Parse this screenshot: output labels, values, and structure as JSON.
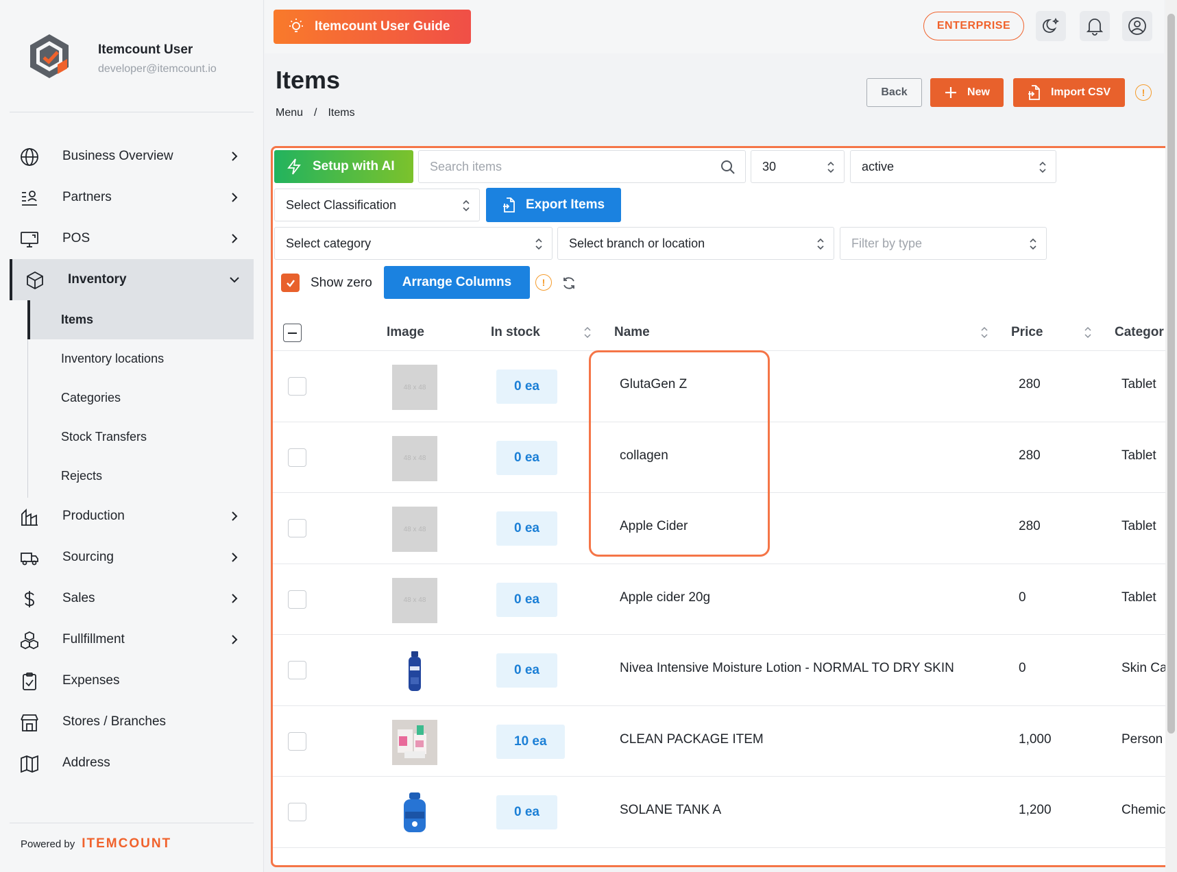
{
  "profile": {
    "name": "Itemcount User",
    "email": "developer@itemcount.io"
  },
  "nav": {
    "business_overview": "Business Overview",
    "partners": "Partners",
    "pos": "POS",
    "inventory": "Inventory",
    "production": "Production",
    "sourcing": "Sourcing",
    "sales": "Sales",
    "fulfillment": "Fullfillment",
    "expenses": "Expenses",
    "stores": "Stores / Branches",
    "address": "Address"
  },
  "subnav": {
    "items": "Items",
    "locations": "Inventory locations",
    "categories": "Categories",
    "transfers": "Stock Transfers",
    "rejects": "Rejects"
  },
  "footer": {
    "powered": "Powered by",
    "brand": "ITEMCOUNT"
  },
  "topbar": {
    "guide": "Itemcount User Guide",
    "plan": "ENTERPRISE"
  },
  "page": {
    "title": "Items",
    "breadcrumb": [
      "Menu",
      "/",
      "Items"
    ],
    "back": "Back",
    "new": "New",
    "import": "Import CSV"
  },
  "toolbar": {
    "ai": "Setup with AI",
    "search_placeholder": "Search items",
    "page_size": "30",
    "status": "active",
    "classification": "Select Classification",
    "export": "Export Items",
    "category": "Select category",
    "branch": "Select branch or location",
    "type_placeholder": "Filter by type",
    "show_zero": "Show zero",
    "arrange": "Arrange Columns"
  },
  "table": {
    "headers": {
      "image": "Image",
      "stock": "In stock",
      "name": "Name",
      "price": "Price",
      "category": "Categor"
    },
    "placeholder_img": "48 x 48",
    "rows": [
      {
        "stock": "0 ea",
        "name": "GlutaGen Z",
        "price": "280",
        "category": "Tablet"
      },
      {
        "stock": "0 ea",
        "name": "collagen",
        "price": "280",
        "category": "Tablet"
      },
      {
        "stock": "0 ea",
        "name": "Apple Cider",
        "price": "280",
        "category": "Tablet"
      },
      {
        "stock": "0 ea",
        "name": "Apple cider 20g",
        "price": "0",
        "category": "Tablet"
      },
      {
        "stock": "0 ea",
        "name": "Nivea Intensive Moisture Lotion - NORMAL TO DRY SKIN",
        "price": "0",
        "category": "Skin Ca"
      },
      {
        "stock": "10 ea",
        "name": "CLEAN PACKAGE ITEM",
        "price": "1,000",
        "category": "Person"
      },
      {
        "stock": "0 ea",
        "name": "SOLANE TANK A",
        "price": "1,200",
        "category": "Chemic"
      }
    ]
  },
  "colors": {
    "accent": "#e8612c",
    "primary": "#1b82e0",
    "stock_bg": "#e6f3fc"
  }
}
